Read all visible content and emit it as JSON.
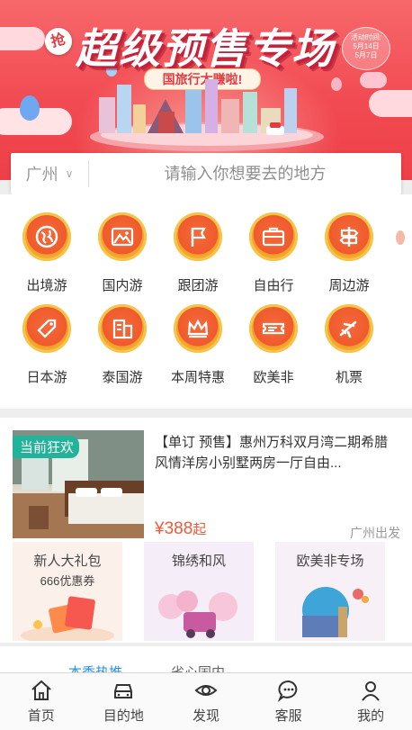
{
  "banner": {
    "badge": "抢",
    "headline": "超级预售专场",
    "ribbon": "国旅行太赚啦!",
    "date_label": "活动时间:",
    "date_start": "5月14日",
    "date_end": "5月7日"
  },
  "search": {
    "city": "广州",
    "placeholder": "请输入你想要去的地方"
  },
  "categories": [
    {
      "label": "出境游",
      "icon": "globe-icon"
    },
    {
      "label": "国内游",
      "icon": "mountain-icon"
    },
    {
      "label": "跟团游",
      "icon": "flag-icon"
    },
    {
      "label": "自由行",
      "icon": "suitcase-icon"
    },
    {
      "label": "周边游",
      "icon": "signpost-icon"
    },
    {
      "label": "日本游",
      "icon": "tag-icon"
    },
    {
      "label": "泰国游",
      "icon": "building-icon"
    },
    {
      "label": "本周特惠",
      "icon": "crown-icon"
    },
    {
      "label": "欧美非",
      "icon": "ticket-icon"
    },
    {
      "label": "机票",
      "icon": "plane-icon"
    }
  ],
  "product": {
    "tag": "当前狂欢",
    "title": "【单订 预售】惠州万科双月湾二期希腊风情洋房小别墅两房一厅自由...",
    "price_symbol": "¥",
    "price": "388",
    "price_suffix": "起",
    "departure": "广州出发"
  },
  "promos": [
    {
      "title": "新人大礼包",
      "subtitle": "666优惠券"
    },
    {
      "title": "锦绣和风",
      "subtitle": ""
    },
    {
      "title": "欧美非专场",
      "subtitle": ""
    }
  ],
  "subtabs": {
    "first": "本季热推",
    "second": "省心国内"
  },
  "nav": [
    {
      "label": "首页",
      "icon": "home-icon"
    },
    {
      "label": "目的地",
      "icon": "car-icon"
    },
    {
      "label": "发现",
      "icon": "eye-icon"
    },
    {
      "label": "客服",
      "icon": "chat-icon"
    },
    {
      "label": "我的",
      "icon": "user-icon"
    }
  ],
  "colors": {
    "accent": "#f24b53",
    "price": "#f05a3a",
    "tag": "#23b39a"
  }
}
